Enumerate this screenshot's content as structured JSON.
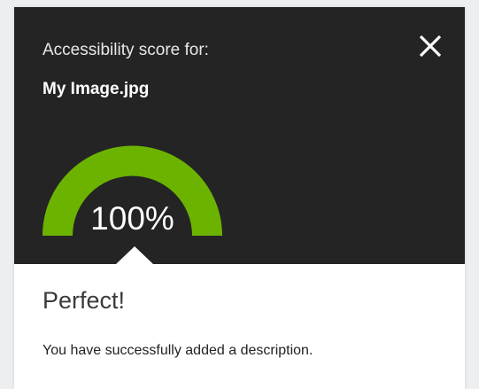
{
  "dialog": {
    "score_label": "Accessibility score for:",
    "file_name": "My Image.jpg",
    "close_icon": "close-icon"
  },
  "score": {
    "value": 100,
    "display": "100%",
    "gauge_color": "#6cb300",
    "track_color": "#242424"
  },
  "result": {
    "heading": "Perfect!",
    "message": "You have successfully added a description."
  },
  "colors": {
    "header_bg": "#242424",
    "panel_bg": "#ffffff",
    "page_bg": "#eceef0"
  }
}
